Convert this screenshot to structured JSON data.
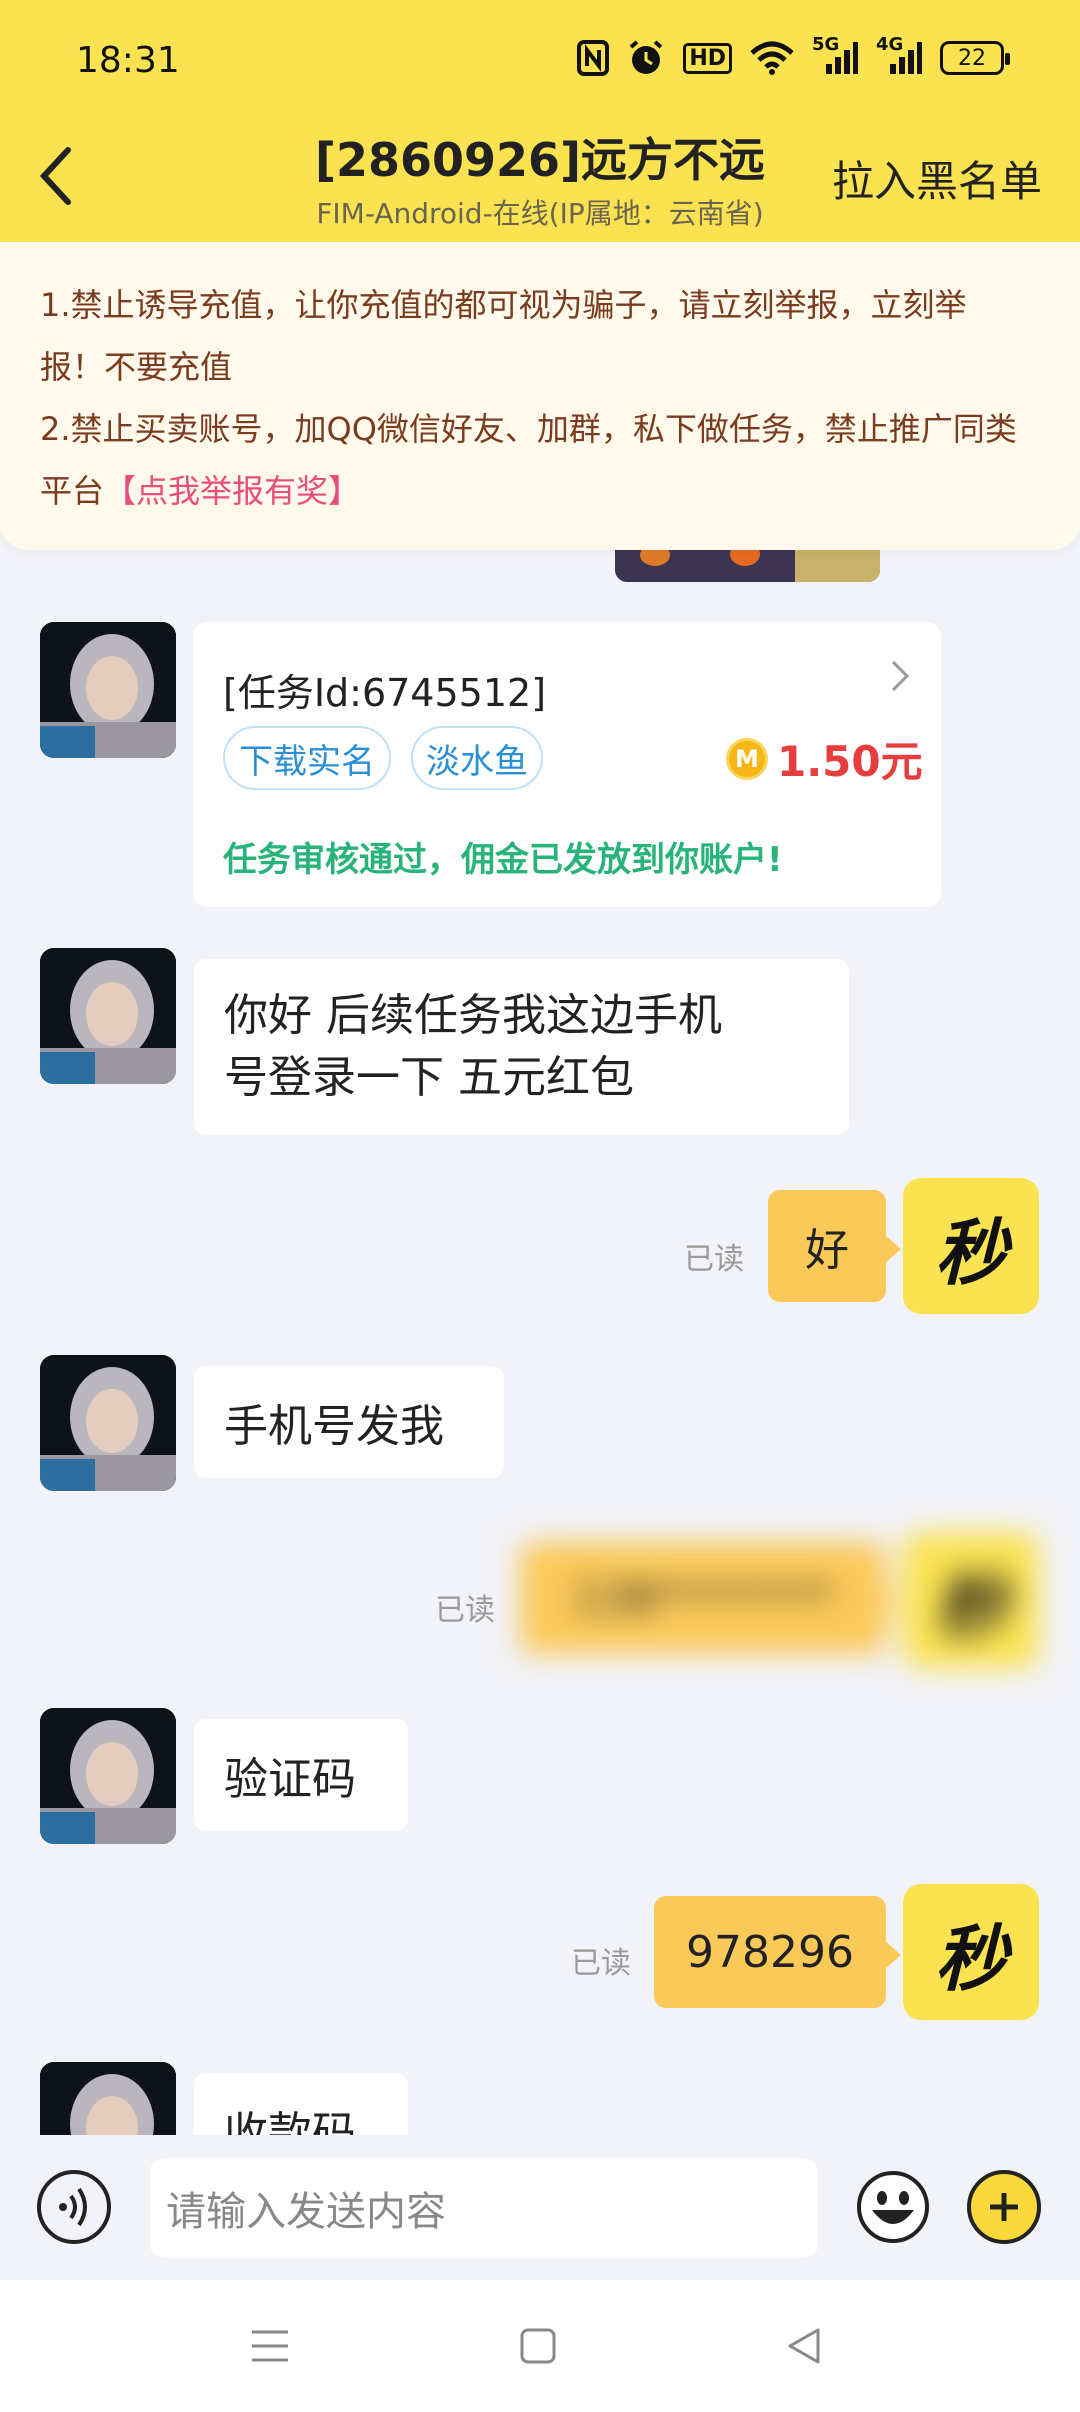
{
  "status_bar": {
    "time": "18:31",
    "icons": [
      "nfc-icon",
      "alarm-icon",
      "hd-icon",
      "wifi-icon",
      "signal-5g-icon",
      "signal-4g-icon",
      "battery-icon"
    ],
    "hd_label": "HD",
    "net1_label": "5G",
    "net2_label": "4G",
    "battery": "22"
  },
  "header": {
    "title": "[2860926]远方不远",
    "subtitle": "FIM-Android-在线(IP属地：云南省)",
    "blacklist_label": "拉入黑名单",
    "accent_color": "#fbe251"
  },
  "notice": {
    "line1": "1.禁止诱导充值，让你充值的都可视为骗子，请立刻举报，立刻举",
    "line2": "报！不要充值",
    "line3": "2.禁止买卖账号，加QQ微信好友、加群，私下做任务，禁止推广同类",
    "line4_prefix": "平台",
    "report_link": "【点我举报有奖】"
  },
  "messages": {
    "task_card": {
      "task_id": "[任务Id:6745512]",
      "tag1": "下载实名",
      "tag2": "淡水鱼",
      "coin_letter": "M",
      "reward": "1.50元",
      "status": "任务审核通过，佣金已发放到你账户!"
    },
    "msg1": "你好 后续任务我这边手机号登录一下 五元红包",
    "msg1_line1": "你好 后续任务我这边手机",
    "msg1_line2": "号登录一下 五元红包",
    "reply1": "好",
    "read_label": "已读",
    "msg2": "手机号发我",
    "reply2_hidden": "138********",
    "msg3": "验证码",
    "reply3": "978296",
    "msg4": "收款码",
    "my_avatar_text": "秒"
  },
  "input": {
    "placeholder": "请输入发送内容"
  }
}
